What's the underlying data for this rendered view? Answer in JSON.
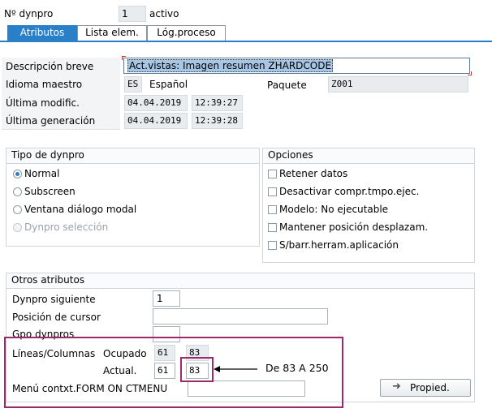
{
  "header": {
    "dynpro_label": "Nº dynpro",
    "dynpro_value": "1",
    "status": "activo"
  },
  "tabs": [
    {
      "label": "Atributos",
      "active": true
    },
    {
      "label": "Lista elem.",
      "active": false
    },
    {
      "label": "Lóg.proceso",
      "active": false
    }
  ],
  "attributes": {
    "descripcion_label": "Descripción breve",
    "descripcion_value": "Act.vistas: Imagen resumen ZHARDCODE",
    "idioma_label": "Idioma maestro",
    "idioma_code": "ES",
    "idioma_name": "Español",
    "paquete_label": "Paquete",
    "paquete_value": "Z001",
    "modif_label": "Última modific.",
    "modif_date": "04.04.2019",
    "modif_time": "12:39:27",
    "gen_label": "Última generación",
    "gen_date": "04.04.2019",
    "gen_time": "12:39:28"
  },
  "tipo": {
    "title": "Tipo de dynpro",
    "options": [
      "Normal",
      "Subscreen",
      "Ventana diálogo modal",
      "Dynpro selección"
    ]
  },
  "opciones": {
    "title": "Opciones",
    "options": [
      "Retener datos",
      "Desactivar compr.tmpo.ejec.",
      "Modelo: No ejecutable",
      "Mantener posición desplazam.",
      "S/barr.herram.aplicación"
    ]
  },
  "otros": {
    "title": "Otros atributos",
    "siguiente_label": "Dynpro siguiente",
    "siguiente_value": "1",
    "cursor_label": "Posición de cursor",
    "gpo_label": "Gpo dynpros",
    "lineas_label": "Líneas/Columnas",
    "ocupado_label": "Ocupado",
    "ocupado_lineas": "61",
    "ocupado_columnas": "83",
    "actual_label": "Actual.",
    "actual_lineas": "61",
    "actual_columnas": "83",
    "menu_label": "Menú contxt.FORM ON CTMENU",
    "propied_label": "Propied."
  },
  "annotation": {
    "text": "De 83 A 250",
    "color": "#9c2a6b"
  },
  "colors": {
    "accent": "#2a7fc9",
    "highlight_border": "#9c2a6b"
  }
}
